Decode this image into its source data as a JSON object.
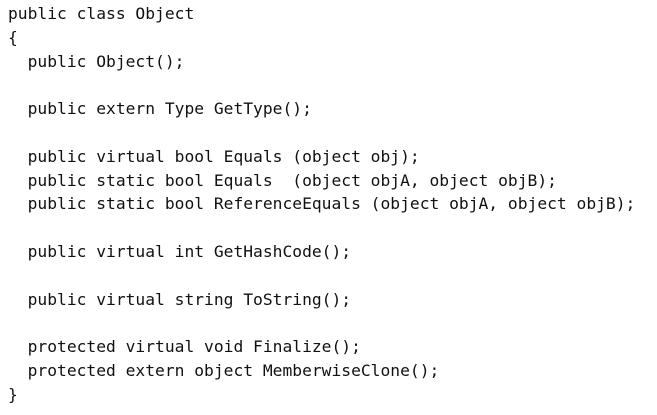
{
  "code": {
    "lines": [
      "public class Object",
      "{",
      "  public Object();",
      "",
      "  public extern Type GetType();",
      "",
      "  public virtual bool Equals (object obj);",
      "  public static bool Equals  (object objA, object objB);",
      "  public static bool ReferenceEquals (object objA, object objB);",
      "",
      "  public virtual int GetHashCode();",
      "",
      "  public virtual string ToString();",
      "",
      "  protected virtual void Finalize();",
      "  protected extern object MemberwiseClone();",
      "}"
    ]
  }
}
